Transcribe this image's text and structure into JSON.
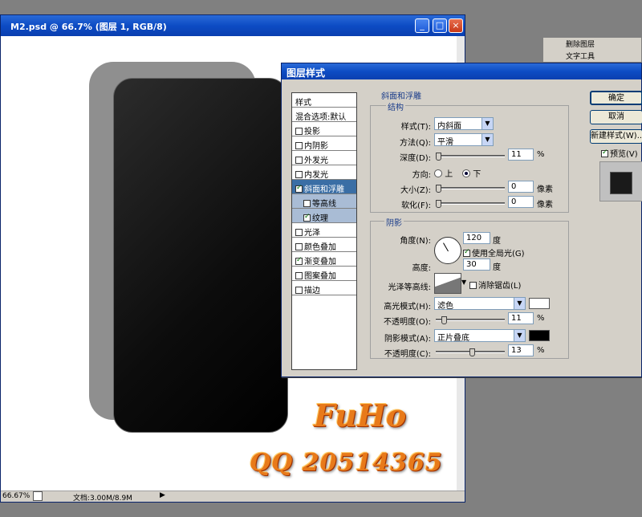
{
  "doc_window": {
    "title": "M2.psd @ 66.7% (图层 1, RGB/8)",
    "zoom": "66.67%",
    "doc_size": "文档:3.00M/8.9M"
  },
  "palette": {
    "items": [
      "删除图层",
      "文字工具"
    ]
  },
  "dialog": {
    "title": "图层样式",
    "styles_header": "样式",
    "blend_defaults": "混合选项:默认",
    "items": [
      {
        "label": "投影",
        "checked": false
      },
      {
        "label": "内阴影",
        "checked": false
      },
      {
        "label": "外发光",
        "checked": false
      },
      {
        "label": "内发光",
        "checked": false
      },
      {
        "label": "斜面和浮雕",
        "checked": true,
        "selected": true
      },
      {
        "label": "等高线",
        "checked": false,
        "sub": true
      },
      {
        "label": "纹理",
        "checked": true,
        "sub": true
      },
      {
        "label": "光泽",
        "checked": false
      },
      {
        "label": "颜色叠加",
        "checked": false
      },
      {
        "label": "渐变叠加",
        "checked": true
      },
      {
        "label": "图案叠加",
        "checked": false
      },
      {
        "label": "描边",
        "checked": false
      }
    ],
    "bevel": {
      "section_title": "斜面和浮雕",
      "structure_title": "结构",
      "style_label": "样式(T):",
      "style_value": "内斜面",
      "technique_label": "方法(Q):",
      "technique_value": "平滑",
      "depth_label": "深度(D):",
      "depth_value": "11",
      "depth_unit": "%",
      "direction_label": "方向:",
      "dir_up": "上",
      "dir_down": "下",
      "size_label": "大小(Z):",
      "size_value": "0",
      "size_unit": "像素",
      "soften_label": "软化(F):",
      "soften_value": "0",
      "soften_unit": "像素"
    },
    "shading": {
      "title": "阴影",
      "angle_label": "角度(N):",
      "angle_value": "120",
      "angle_unit": "度",
      "global_light": "使用全局光(G)",
      "altitude_label": "高度:",
      "altitude_value": "30",
      "altitude_unit": "度",
      "gloss_label": "光泽等高线:",
      "antialias": "消除锯齿(L)",
      "highlight_label": "高光模式(H):",
      "highlight_mode": "滤色",
      "highlight_opacity_label": "不透明度(O):",
      "highlight_opacity": "11",
      "highlight_color": "#ffffff",
      "shadow_label": "阴影模式(A):",
      "shadow_mode": "正片叠底",
      "shadow_opacity_label": "不透明度(C):",
      "shadow_opacity": "13",
      "shadow_color": "#000000",
      "pct": "%"
    },
    "buttons": {
      "ok": "确定",
      "cancel": "取消",
      "new_style": "新建样式(W)...",
      "preview": "预览(V)"
    }
  },
  "watermark": {
    "line1": "FuHo",
    "line2": "QQ 20514365"
  }
}
